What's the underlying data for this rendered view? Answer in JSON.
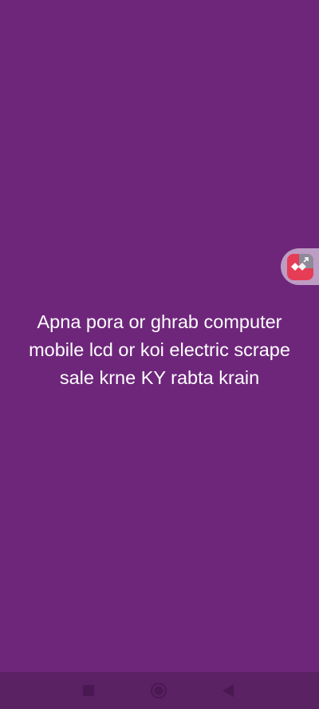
{
  "colors": {
    "background": "#6e267b",
    "navbar": "#5a2163",
    "nav_icon": "#4a1852",
    "text": "#ffffff",
    "bubble_red": "#e63d56"
  },
  "story": {
    "text": "Apna pora or ghrab computer mobile lcd or koi electric scrape sale krne KY rabta krain"
  },
  "floating_bubble": {
    "icon": "remote-app-icon"
  },
  "navbar": {
    "recents_icon": "square-recents-icon",
    "home_icon": "circle-home-icon",
    "back_icon": "triangle-back-icon"
  }
}
